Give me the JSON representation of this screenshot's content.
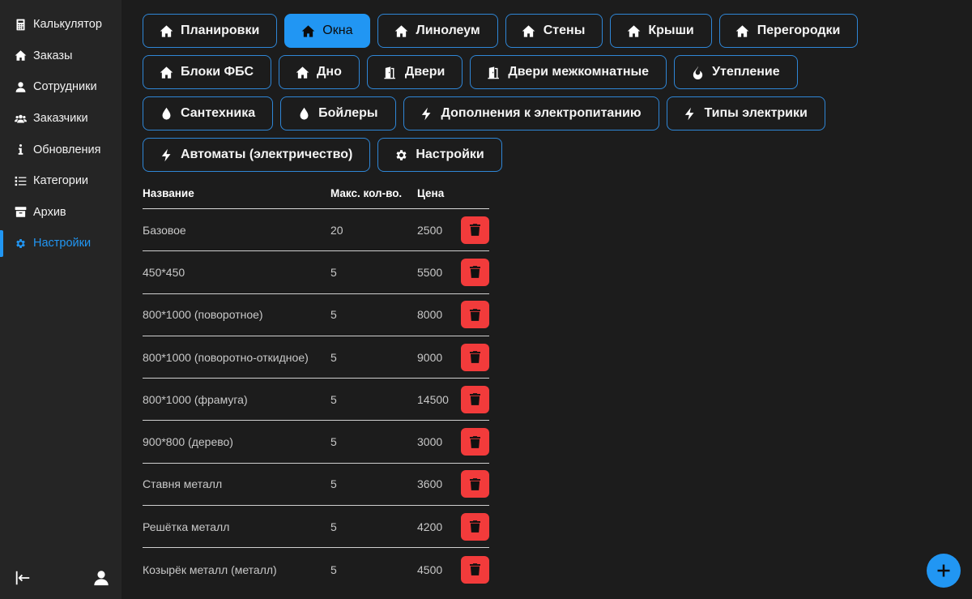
{
  "sidebar": {
    "items": [
      {
        "label": "Калькулятор",
        "icon": "calculator-icon"
      },
      {
        "label": "Заказы",
        "icon": "home-icon"
      },
      {
        "label": "Сотрудники",
        "icon": "user-icon"
      },
      {
        "label": "Заказчики",
        "icon": "users-icon"
      },
      {
        "label": "Обновления",
        "icon": "info-icon"
      },
      {
        "label": "Категории",
        "icon": "list-icon"
      },
      {
        "label": "Архив",
        "icon": "archive-icon"
      },
      {
        "label": "Настройки",
        "icon": "gear-icon",
        "active": true
      }
    ]
  },
  "categories": [
    {
      "label": "Планировки",
      "icon": "home-icon"
    },
    {
      "label": "Окна",
      "icon": "home-icon",
      "active": true
    },
    {
      "label": "Линолеум",
      "icon": "home-icon"
    },
    {
      "label": "Стены",
      "icon": "home-icon"
    },
    {
      "label": "Крыши",
      "icon": "home-icon"
    },
    {
      "label": "Перегородки",
      "icon": "home-icon"
    },
    {
      "label": "Блоки ФБС",
      "icon": "home-icon"
    },
    {
      "label": "Дно",
      "icon": "home-icon"
    },
    {
      "label": "Двери",
      "icon": "door-icon"
    },
    {
      "label": "Двери межкомнатные",
      "icon": "door-icon"
    },
    {
      "label": "Утепление",
      "icon": "fire-icon"
    },
    {
      "label": "Сантехника",
      "icon": "drop-icon"
    },
    {
      "label": "Бойлеры",
      "icon": "drop-icon"
    },
    {
      "label": "Дополнения к электропитанию",
      "icon": "bolt-icon"
    },
    {
      "label": "Типы электрики",
      "icon": "bolt-icon"
    },
    {
      "label": "Автоматы (электричество)",
      "icon": "bolt-icon"
    },
    {
      "label": "Настройки",
      "icon": "gear-icon"
    }
  ],
  "table": {
    "headers": {
      "name": "Название",
      "qty": "Макс. кол-во.",
      "price": "Цена"
    },
    "rows": [
      {
        "name": "Базовое",
        "qty": "20",
        "price": "2500"
      },
      {
        "name": "450*450",
        "qty": "5",
        "price": "5500"
      },
      {
        "name": "800*1000 (поворотное)",
        "qty": "5",
        "price": "8000"
      },
      {
        "name": "800*1000 (поворотно-откидное)",
        "qty": "5",
        "price": "9000"
      },
      {
        "name": "800*1000 (фрамуга)",
        "qty": "5",
        "price": "14500"
      },
      {
        "name": "900*800 (дерево)",
        "qty": "5",
        "price": "3000"
      },
      {
        "name": "Ставня металл",
        "qty": "5",
        "price": "3600"
      },
      {
        "name": "Решётка металл",
        "qty": "5",
        "price": "4200"
      },
      {
        "name": "Козырёк металл (металл)",
        "qty": "5",
        "price": "4500"
      }
    ]
  },
  "colors": {
    "accent": "#2196f3",
    "danger": "#f23b3b",
    "background": "#1c1c1c",
    "sidebar": "#252525"
  }
}
